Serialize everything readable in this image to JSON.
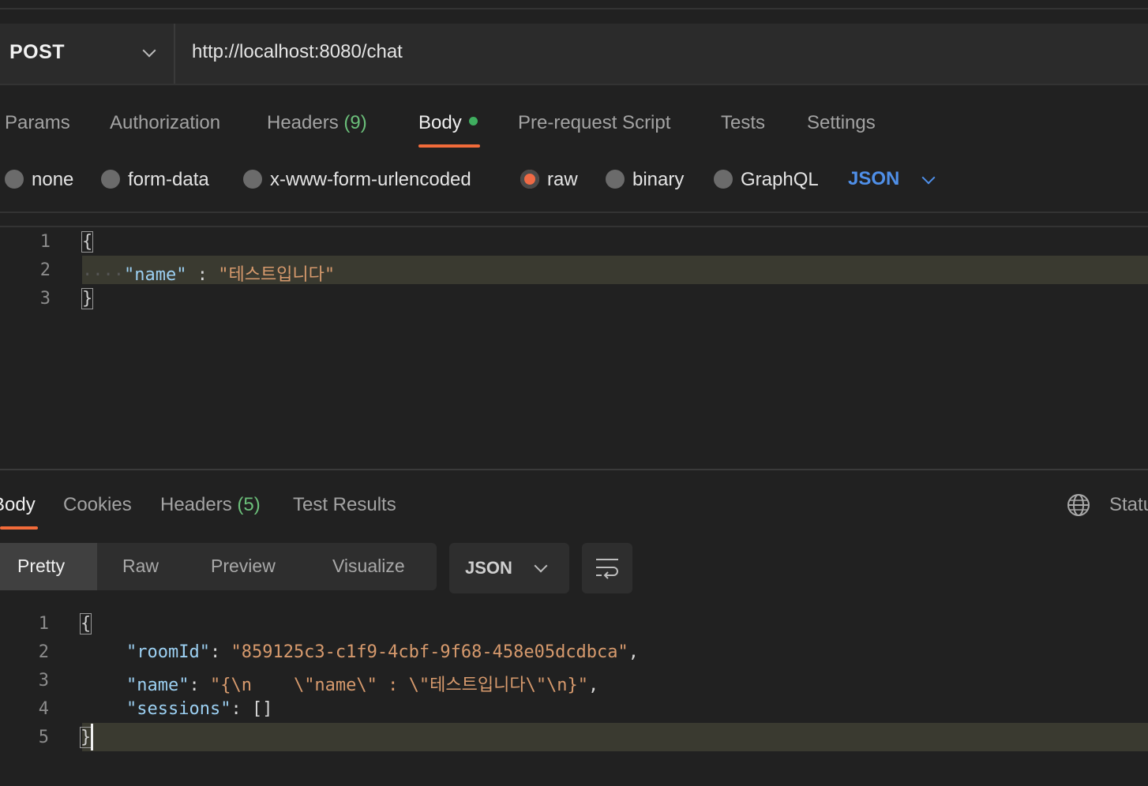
{
  "request": {
    "method": "POST",
    "url": "http://localhost:8080/chat",
    "tabs": [
      {
        "label": "Params"
      },
      {
        "label": "Authorization"
      },
      {
        "label": "Headers",
        "count": "(9)"
      },
      {
        "label": "Body"
      },
      {
        "label": "Pre-request Script"
      },
      {
        "label": "Tests"
      },
      {
        "label": "Settings"
      }
    ],
    "active_tab": "Body",
    "body_types": [
      "none",
      "form-data",
      "x-www-form-urlencoded",
      "raw",
      "binary",
      "GraphQL"
    ],
    "selected_body_type": "raw",
    "language": "JSON",
    "editor": {
      "line_numbers": [
        "1",
        "2",
        "3"
      ],
      "open_brace": "{",
      "close_brace": "}",
      "indent_dots": "····",
      "key": "\"name\"",
      "separator": " : ",
      "value": "\"테스트입니다\""
    }
  },
  "response": {
    "tabs": [
      {
        "label": "Body"
      },
      {
        "label": "Cookies"
      },
      {
        "label": "Headers",
        "count": "(5)"
      },
      {
        "label": "Test Results"
      }
    ],
    "status_partial": "Statu",
    "view_modes": [
      "Pretty",
      "Raw",
      "Preview",
      "Visualize"
    ],
    "active_view": "Pretty",
    "format": "JSON",
    "code": {
      "line_numbers": [
        "1",
        "2",
        "3",
        "4",
        "5"
      ],
      "open_brace": "{",
      "close_brace": "}",
      "lines": [
        {
          "key": "\"roomId\"",
          "sep": ": ",
          "value": "\"859125c3-c1f9-4cbf-9f68-458e05dcdbca\"",
          "tail": ","
        },
        {
          "key": "\"name\"",
          "sep": ": ",
          "value": "\"{\\n    \\\"name\\\" : \\\"테스트입니다\\\"\\n}\"",
          "tail": ","
        },
        {
          "key": "\"sessions\"",
          "sep": ": ",
          "value": "[]",
          "tail": ""
        }
      ]
    }
  },
  "colors": {
    "background": "#212121",
    "accent_orange": "#f26b3a",
    "accent_blue": "#4f8fe8",
    "count_green": "#6bbf7a",
    "json_key": "#9cd0f2",
    "json_string": "#d79a6d"
  },
  "icons": {
    "method_dropdown": "chevron-down-icon",
    "language_dropdown": "chevron-down-icon",
    "response_globe": "globe-icon",
    "wrap_lines": "wrap-lines-icon"
  }
}
